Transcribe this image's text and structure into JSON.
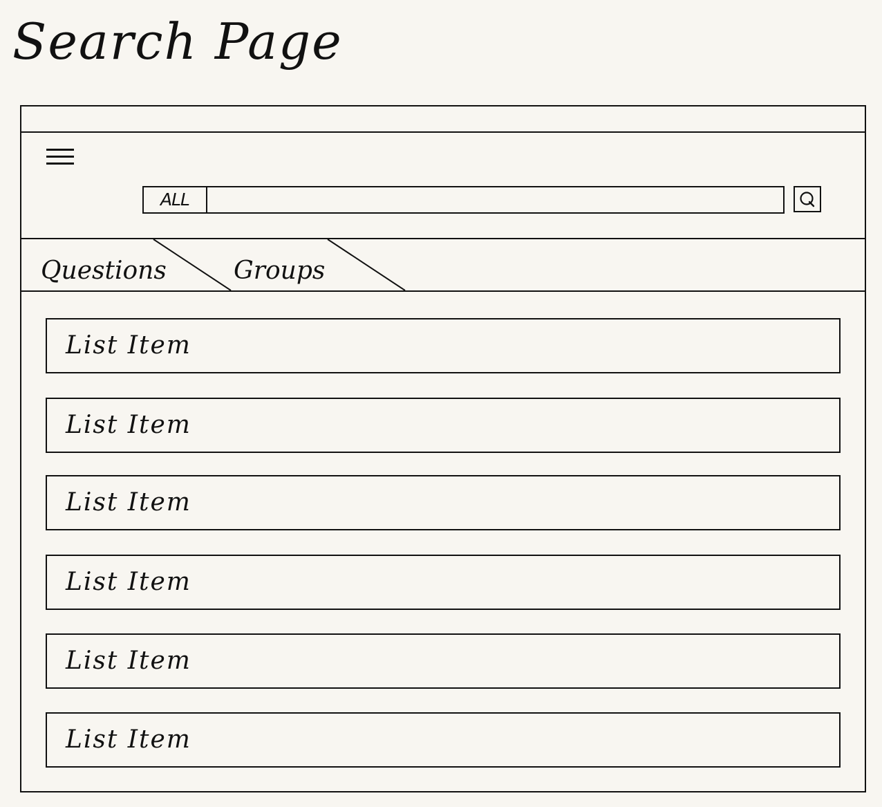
{
  "page": {
    "title": "Search Page"
  },
  "header": {
    "menu_icon": "hamburger-menu-icon",
    "search": {
      "scope_label": "ALL",
      "query_value": "",
      "placeholder": "",
      "button_icon": "search-icon"
    }
  },
  "tabs": [
    {
      "label": "Questions"
    },
    {
      "label": "Groups"
    }
  ],
  "list": {
    "items": [
      {
        "label": "List Item"
      },
      {
        "label": "List Item"
      },
      {
        "label": "List Item"
      },
      {
        "label": "List Item"
      },
      {
        "label": "List Item"
      },
      {
        "label": "List Item"
      }
    ]
  }
}
